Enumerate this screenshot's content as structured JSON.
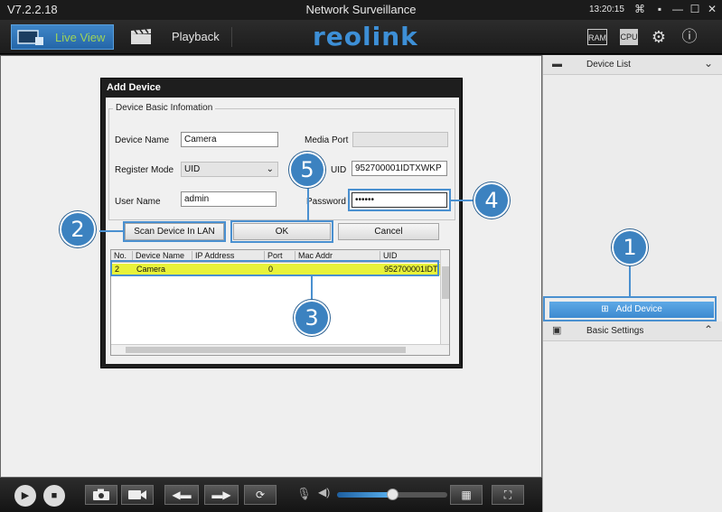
{
  "app": {
    "version": "V7.2.2.18",
    "title": "Network Surveillance",
    "clock": "13:20:15",
    "window_buttons": [
      "⌘",
      "▪",
      "—",
      "☐",
      "✕"
    ]
  },
  "toolbar": {
    "live_view_label": "Live View",
    "playback_label": "Playback",
    "logo_text": "reolink",
    "icon_ram": "RAM",
    "icon_cpu": "CPU",
    "icon_settings": "⚙",
    "icon_info": "ⓘ"
  },
  "sidebar": {
    "device_list_label": "Device List",
    "add_device_label": "Add Device",
    "basic_settings_label": "Basic Settings"
  },
  "dialog": {
    "title": "Add Device",
    "group_label": "Device Basic Infomation",
    "device_name_label": "Device Name",
    "device_name_value": "Camera",
    "media_port_label": "Media Port",
    "media_port_value": "",
    "register_mode_label": "Register Mode",
    "register_mode_value": "UID",
    "uid_label": "UID",
    "uid_value": "952700001IDTXWKP",
    "user_name_label": "User Name",
    "user_name_value": "admin",
    "password_label": "Password",
    "password_value": "••••••",
    "scan_button": "Scan Device In LAN",
    "ok_button": "OK",
    "cancel_button": "Cancel",
    "table": {
      "headers": [
        "No.",
        "Device Name",
        "IP Address",
        "Port",
        "Mac Addr",
        "UID"
      ],
      "rows": [
        [
          "2",
          "Camera",
          "",
          "0",
          "",
          "952700001IDT"
        ]
      ]
    }
  },
  "callouts": [
    "1",
    "2",
    "3",
    "4",
    "5"
  ],
  "bottombar": {
    "play": "▶",
    "stop": "■",
    "snapshot": "📷",
    "record": "🎥",
    "prev": "◀▬",
    "next": "▬▶",
    "sync": "⟳",
    "mic": "🎙",
    "volume_fraction": 0.5,
    "layout": "▦",
    "fullscreen": "⛶"
  },
  "colors": {
    "accent": "#3c82c0",
    "selected_row": "#e8f23a",
    "live_view_text": "#9ed35a"
  }
}
